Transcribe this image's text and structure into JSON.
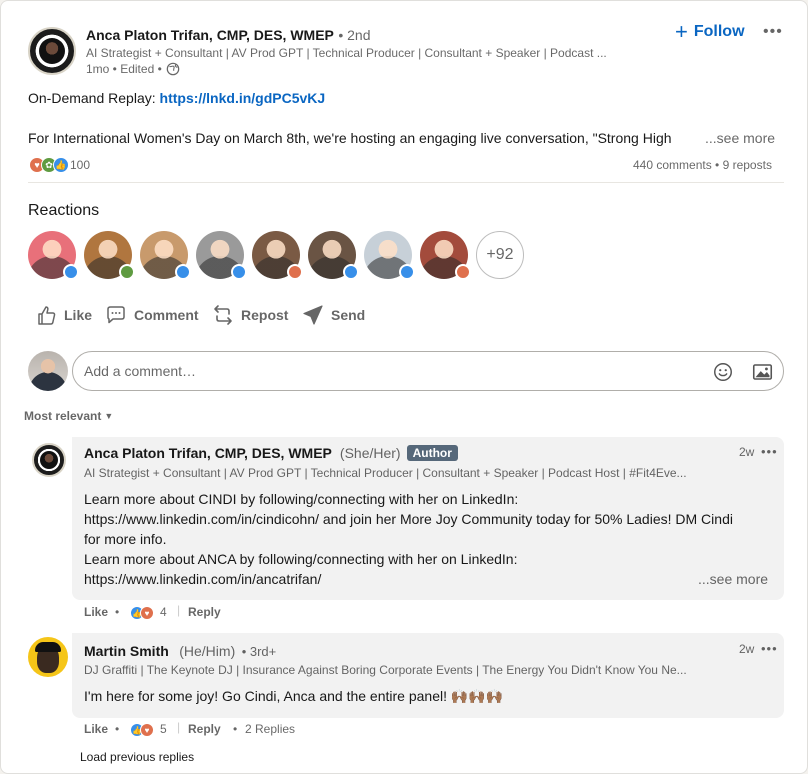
{
  "post": {
    "author_name": "Anca Platon Trifan, CMP, DES, WMEP",
    "degree": "• 2nd",
    "headline": "AI Strategist + Consultant | AV Prod GPT | Technical Producer | Consultant + Speaker | Podcast ...",
    "meta": "1mo • Edited •",
    "follow_label": "Follow",
    "menu_label": "•••",
    "replay_prefix": "On-Demand Replay: ",
    "replay_link": "https://lnkd.in/gdPC5vKJ",
    "body_line": "For International Women's Day on March 8th, we're hosting an engaging live conversation, \"Strong High",
    "see_more": "...see more",
    "reaction_count": "100",
    "comments_count": "440 comments",
    "reposts_count": "• 9 reposts"
  },
  "reactions": {
    "title": "Reactions",
    "more_count": "+92",
    "avatars": [
      {
        "name": "reactor-1",
        "bg": "#e8707a",
        "badge": "#378fe9"
      },
      {
        "name": "reactor-2",
        "bg": "#b0763f",
        "badge": "#5f9b41"
      },
      {
        "name": "reactor-3",
        "bg": "#c89a6c",
        "badge": "#378fe9"
      },
      {
        "name": "reactor-4",
        "bg": "#9a9a9a",
        "badge": "#378fe9"
      },
      {
        "name": "reactor-5",
        "bg": "#7a5a44",
        "badge": "#df704d"
      },
      {
        "name": "reactor-6",
        "bg": "#6a5444",
        "badge": "#378fe9"
      },
      {
        "name": "reactor-7",
        "bg": "#c7d0d8",
        "badge": "#378fe9"
      },
      {
        "name": "reactor-8",
        "bg": "#a34b3c",
        "badge": "#df704d"
      }
    ]
  },
  "actions": {
    "like": "Like",
    "comment": "Comment",
    "repost": "Repost",
    "send": "Send"
  },
  "comment_input": {
    "placeholder": "Add a comment…"
  },
  "sort": {
    "label": "Most relevant"
  },
  "comments": [
    {
      "author": "Anca Platon Trifan, CMP, DES, WMEP",
      "pronouns": "(She/Her)",
      "badge": "Author",
      "time": "2w",
      "headline": "AI Strategist + Consultant | AV Prod GPT | Technical Producer | Consultant + Speaker | Podcast Host | #Fit4Eve...",
      "lines": [
        "Learn more about CINDI by following/connecting with her on LinkedIn:",
        "https://www.linkedin.com/in/cindicohn/ and join her More Joy Community today for 50% Ladies! DM Cindi",
        "for more info.",
        "Learn more about ANCA by following/connecting with her on LinkedIn:",
        "https://www.linkedin.com/in/ancatrifan/"
      ],
      "see_more": "...see more",
      "like_label": "Like",
      "reaction_count": "4",
      "reply_label": "Reply"
    },
    {
      "author": "Martin Smith",
      "pronouns": "(He/Him)",
      "degree": "• 3rd+",
      "time": "2w",
      "headline": "DJ Graffiti | The Keynote DJ | Insurance Against Boring Corporate Events | The Energy You Didn't Know You Ne...",
      "text": "I'm here for some joy! Go Cindi, Anca and the entire panel! 🙌🏾🙌🏾🙌🏾",
      "like_label": "Like",
      "reaction_count": "5",
      "reply_label": "Reply",
      "replies_label": "2 Replies"
    }
  ],
  "load_previous": "Load previous replies"
}
